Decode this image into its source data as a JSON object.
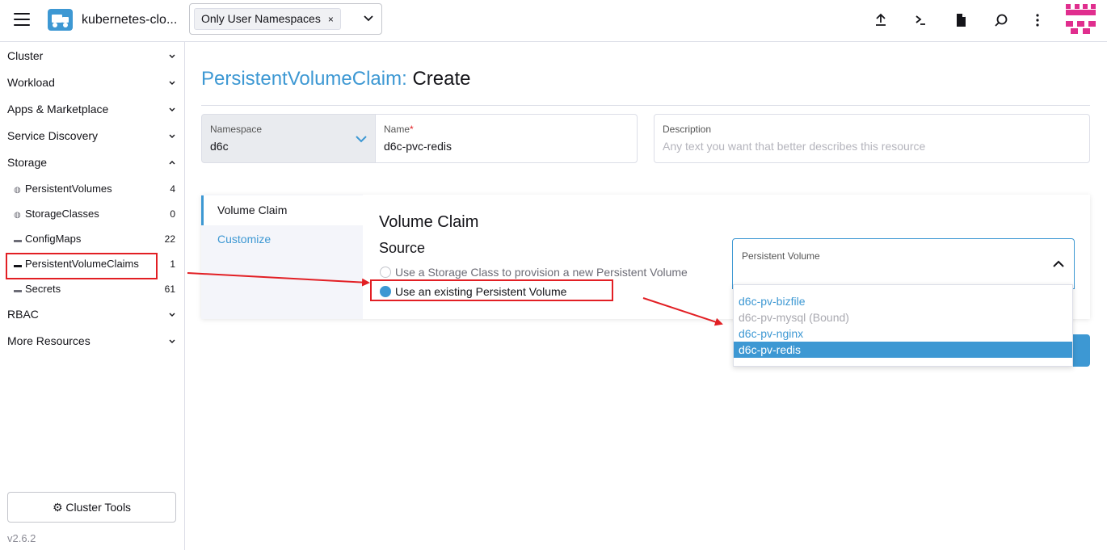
{
  "header": {
    "cluster_name": "kubernetes-clo...",
    "namespace_filter": {
      "chip": "Only User Namespaces",
      "chip_remove": "×"
    },
    "icons": [
      "upload-icon",
      "terminal-icon",
      "file-icon",
      "search-icon",
      "more-vert-icon"
    ]
  },
  "sidebar": {
    "groups": {
      "cluster": "Cluster",
      "workload": "Workload",
      "apps": "Apps & Marketplace",
      "service_discovery": "Service Discovery",
      "storage": "Storage",
      "rbac": "RBAC",
      "more": "More Resources"
    },
    "storage_items": [
      {
        "label": "PersistentVolumes",
        "count": "4"
      },
      {
        "label": "StorageClasses",
        "count": "0"
      },
      {
        "label": "ConfigMaps",
        "count": "22"
      },
      {
        "label": "PersistentVolumeClaims",
        "count": "1"
      },
      {
        "label": "Secrets",
        "count": "61"
      }
    ],
    "cluster_tools": "Cluster Tools",
    "version": "v2.6.2"
  },
  "main": {
    "title_resource": "PersistentVolumeClaim:",
    "title_action": "Create",
    "namespace": {
      "label": "Namespace",
      "value": "d6c"
    },
    "name": {
      "label": "Name",
      "required": "*",
      "value": "d6c-pvc-redis"
    },
    "description": {
      "label": "Description",
      "placeholder": "Any text you want that better describes this resource"
    },
    "tabs": [
      {
        "label": "Volume Claim"
      },
      {
        "label": "Customize"
      }
    ],
    "volume_claim": {
      "title": "Volume Claim",
      "source_title": "Source",
      "option_new": "Use a Storage Class to provision a new Persistent Volume",
      "option_existing": "Use an existing Persistent Volume"
    },
    "persistent_volume": {
      "label": "Persistent Volume",
      "options": [
        {
          "label": "d6c-pv-bizfile"
        },
        {
          "label": "d6c-pv-mysql (Bound)"
        },
        {
          "label": "d6c-pv-nginx"
        },
        {
          "label": "d6c-pv-redis"
        }
      ]
    }
  },
  "colors": {
    "accent": "#3d98d3",
    "annotation_red": "#e21f24",
    "brand_magenta": "#e02e8e"
  }
}
